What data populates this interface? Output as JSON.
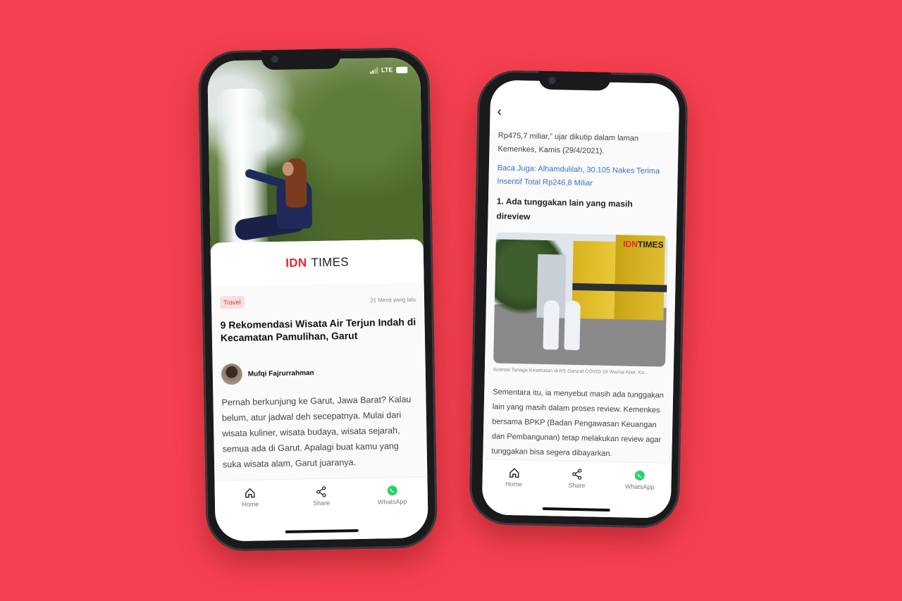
{
  "left_phone": {
    "status": {
      "network": "LTE"
    },
    "logo": {
      "brand_red": "IDN",
      "brand_dark": "TIMES"
    },
    "article": {
      "category": "Travel",
      "time_ago": "21 Menit yang lalu",
      "title": "9 Rekomendasi Wisata Air Terjun Indah di Kecamatan Pamulihan, Garut",
      "author": "Mufqi Fajrurrahman",
      "body": "Pernah berkunjung ke Garut, Jawa Barat? Kalau belum, atur jadwal deh secepatnya. Mulai dari wisata kuliner, wisata budaya, wisata sejarah, semua ada di Garut. Apalagi buat kamu yang suka wisata alam, Garut juaranya."
    },
    "tabs": {
      "home": "Home",
      "share": "Share",
      "whatsapp": "WhatsApp"
    }
  },
  "right_phone": {
    "content": {
      "intro": "Rp475,7 miliar,” ujar dikutip dalam laman Kemenkes, Kamis (29/4/2021).",
      "related_link": "Baca Juga: Alhamdulilah, 30.105 Nakes Terima Insentif Total Rp246,8 Miliar",
      "heading": "1. Ada tunggakan lain yang masih direview",
      "image_logo_red": "IDN",
      "image_logo_dark": "TIMES",
      "caption": "Ilustrasi Tenaga Kesehatan di RS Darurat COVID-19 Wisma Atlet, Ke...",
      "body": "Sementara itu, ia menyebut masih ada tunggakan lain yang masih dalam proses review. Kemenkes bersama BPKP (Badan Pengawasan Keuangan dan Pembangunan) tetap melakukan review agar tunggakan bisa segera dibayarkan."
    },
    "tabs": {
      "home": "Home",
      "share": "Share",
      "whatsapp": "WhatsApp"
    }
  },
  "colors": {
    "background": "#f5404f",
    "brand_red": "#e3262f",
    "link_blue": "#3a6fd0",
    "whatsapp_green": "#25d366"
  }
}
